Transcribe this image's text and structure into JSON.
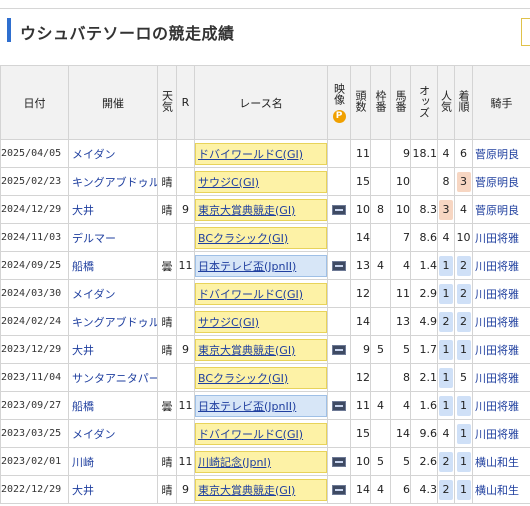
{
  "page": {
    "title": "ウシュバテソーロの競走成績"
  },
  "table": {
    "headers": {
      "date": "日付",
      "venue": "開催",
      "weather": "天気",
      "round": "R",
      "race": "レース名",
      "movie": "映像",
      "heads": "頭数",
      "frame": "枠番",
      "horse_no": "馬番",
      "odds": "オッズ",
      "popularity": "人気",
      "finish": "着順",
      "jockey": "騎手"
    },
    "rows": [
      {
        "date": "2025/04/05",
        "venue": "メイダン",
        "weather": "",
        "round": "",
        "race": "ドバイワールドC(GI)",
        "grade": "g1",
        "video": false,
        "heads": "11",
        "frame": "",
        "horse_no": "9",
        "odds": "18.1",
        "pop": "4",
        "finish": "6",
        "jockey": "菅原明良"
      },
      {
        "date": "2025/02/23",
        "venue": "キングアブドゥル",
        "weather": "晴",
        "round": "",
        "race": "サウジC(GI)",
        "grade": "g1",
        "video": false,
        "heads": "15",
        "frame": "",
        "horse_no": "10",
        "odds": "",
        "pop": "8",
        "finish": "3",
        "jockey": "菅原明良"
      },
      {
        "date": "2024/12/29",
        "venue": "大井",
        "weather": "晴",
        "round": "9",
        "race": "東京大賞典競走(GI)",
        "grade": "g1",
        "video": true,
        "heads": "10",
        "frame": "8",
        "horse_no": "10",
        "odds": "8.3",
        "pop": "3",
        "finish": "4",
        "jockey": "菅原明良"
      },
      {
        "date": "2024/11/03",
        "venue": "デルマー",
        "weather": "",
        "round": "",
        "race": "BCクラシック(GI)",
        "grade": "g1",
        "video": false,
        "heads": "14",
        "frame": "",
        "horse_no": "7",
        "odds": "8.6",
        "pop": "4",
        "finish": "10",
        "jockey": "川田将雅"
      },
      {
        "date": "2024/09/25",
        "venue": "船橋",
        "weather": "曇",
        "round": "11",
        "race": "日本テレビ盃(JpnII)",
        "grade": "jpn",
        "video": true,
        "heads": "13",
        "frame": "4",
        "horse_no": "4",
        "odds": "1.4",
        "pop": "1",
        "finish": "2",
        "jockey": "川田将雅"
      },
      {
        "date": "2024/03/30",
        "venue": "メイダン",
        "weather": "",
        "round": "",
        "race": "ドバイワールドC(GI)",
        "grade": "g1",
        "video": false,
        "heads": "12",
        "frame": "",
        "horse_no": "11",
        "odds": "2.9",
        "pop": "1",
        "finish": "2",
        "jockey": "川田将雅"
      },
      {
        "date": "2024/02/24",
        "venue": "キングアブドゥル",
        "weather": "晴",
        "round": "",
        "race": "サウジC(GI)",
        "grade": "g1",
        "video": false,
        "heads": "14",
        "frame": "",
        "horse_no": "13",
        "odds": "4.9",
        "pop": "2",
        "finish": "2",
        "jockey": "川田将雅"
      },
      {
        "date": "2023/12/29",
        "venue": "大井",
        "weather": "晴",
        "round": "9",
        "race": "東京大賞典競走(GI)",
        "grade": "g1",
        "video": true,
        "heads": "9",
        "frame": "5",
        "horse_no": "5",
        "odds": "1.7",
        "pop": "1",
        "finish": "1",
        "jockey": "川田将雅"
      },
      {
        "date": "2023/11/04",
        "venue": "サンタアニタパー",
        "weather": "",
        "round": "",
        "race": "BCクラシック(GI)",
        "grade": "g1",
        "video": false,
        "heads": "12",
        "frame": "",
        "horse_no": "8",
        "odds": "2.1",
        "pop": "1",
        "finish": "5",
        "jockey": "川田将雅"
      },
      {
        "date": "2023/09/27",
        "venue": "船橋",
        "weather": "曇",
        "round": "11",
        "race": "日本テレビ盃(JpnII)",
        "grade": "jpn",
        "video": true,
        "heads": "11",
        "frame": "4",
        "horse_no": "4",
        "odds": "1.6",
        "pop": "1",
        "finish": "1",
        "jockey": "川田将雅"
      },
      {
        "date": "2023/03/25",
        "venue": "メイダン",
        "weather": "",
        "round": "",
        "race": "ドバイワールドC(GI)",
        "grade": "g1",
        "video": false,
        "heads": "15",
        "frame": "",
        "horse_no": "14",
        "odds": "9.6",
        "pop": "4",
        "finish": "1",
        "jockey": "川田将雅"
      },
      {
        "date": "2023/02/01",
        "venue": "川崎",
        "weather": "晴",
        "round": "11",
        "race": "川崎記念(JpnI)",
        "grade": "g1",
        "video": true,
        "heads": "10",
        "frame": "5",
        "horse_no": "5",
        "odds": "2.6",
        "pop": "2",
        "finish": "1",
        "jockey": "横山和生"
      },
      {
        "date": "2022/12/29",
        "venue": "大井",
        "weather": "晴",
        "round": "9",
        "race": "東京大賞典競走(GI)",
        "grade": "g1",
        "video": true,
        "heads": "14",
        "frame": "4",
        "horse_no": "6",
        "odds": "4.3",
        "pop": "2",
        "finish": "1",
        "jockey": "横山和生"
      }
    ]
  },
  "colors": {
    "accent": "#2f6fcf",
    "link": "#1f3f9f",
    "g1_chip": "#fdf2a6",
    "jpn_chip": "#d7e6f7",
    "rank_blue": "#cfe0f7",
    "rank_orange": "#f7d6c2"
  }
}
